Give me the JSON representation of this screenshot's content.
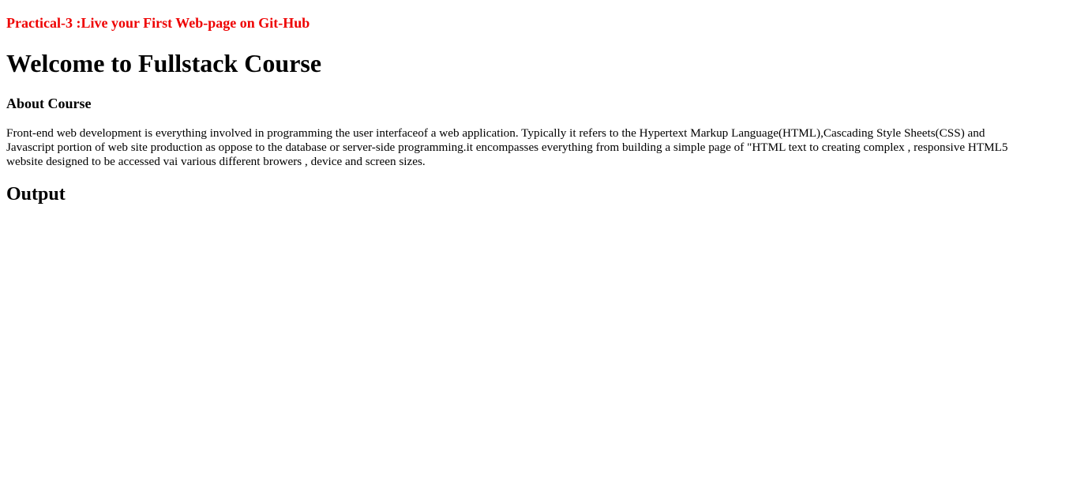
{
  "header": {
    "practical": "Practical-3 :Live your First Web-page on Git-Hub",
    "accent_color": "#ee0000"
  },
  "main": {
    "title": "Welcome to Fullstack Course",
    "about_heading": "About Course",
    "about_lines": [
      "Front-end web development is everything involved in programming the user interfaceof a web application. Typically it refers to the Hypertext Markup Language(HTML),Cascading Style Sheets(CSS) and",
      "Javascript portion of web site production as oppose to the database or server-side programming.it encompasses everything from building a simple page of \"HTML text to creating complex , responsive HTML5",
      "website designed to be accessed vai various different browers , device and screen sizes."
    ],
    "output_heading": "Output"
  }
}
